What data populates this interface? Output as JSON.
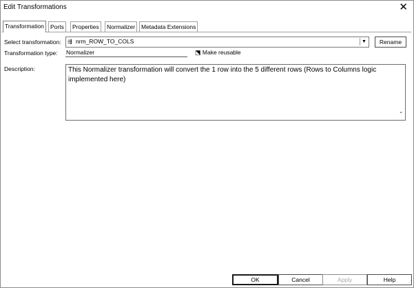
{
  "window": {
    "title": "Edit Transformations",
    "close_glyph": "✕"
  },
  "tabs": [
    {
      "label": "Transformation",
      "active": true
    },
    {
      "label": "Ports",
      "active": false
    },
    {
      "label": "Properties",
      "active": false
    },
    {
      "label": "Normalizer",
      "active": false
    },
    {
      "label": "Metadata Extensions",
      "active": false
    }
  ],
  "form": {
    "select_label": "Select transformation:",
    "select_value": "nrm_ROW_TO_COLS",
    "select_icon": "normalizer-transformation-icon",
    "rename_label": "Rename",
    "type_label": "Transformation type:",
    "type_value": "Normalizer",
    "reusable_label": "Make reusable",
    "reusable_icon": "make-reusable-icon",
    "description_label": "Description:",
    "description_value": "This Normalizer transformation will convert the 1 row into the 5 different rows (Rows to Columns logic implemented here)"
  },
  "buttons": {
    "ok": "OK",
    "cancel": "Cancel",
    "apply": "Apply",
    "help": "Help"
  }
}
